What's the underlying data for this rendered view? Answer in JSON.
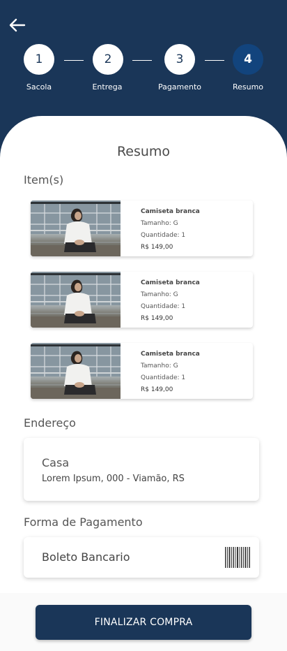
{
  "steps": [
    {
      "number": "1",
      "label": "Sacola"
    },
    {
      "number": "2",
      "label": "Entrega"
    },
    {
      "number": "3",
      "label": "Pagamento"
    },
    {
      "number": "4",
      "label": "Resumo"
    }
  ],
  "active_step": 4,
  "page_title": "Resumo",
  "items_section_title": "Item(s)",
  "items": [
    {
      "name": "Camiseta branca",
      "size_label": "Tamanho:",
      "size": "G",
      "qty_label": "Quantidade:",
      "qty": "1",
      "price": "R$ 149,00"
    },
    {
      "name": "Camiseta branca",
      "size_label": "Tamanho:",
      "size": "G",
      "qty_label": "Quantidade:",
      "qty": "1",
      "price": "R$ 149,00"
    },
    {
      "name": "Camiseta branca",
      "size_label": "Tamanho:",
      "size": "G",
      "qty_label": "Quantidade:",
      "qty": "1",
      "price": "R$ 149,00"
    }
  ],
  "address_section_title": "Endereço",
  "address": {
    "name": "Casa",
    "line": "Lorem Ipsum, 000 - Viamão, RS"
  },
  "payment_section_title": "Forma de Pagamento",
  "payment": {
    "method": "Boleto Bancario",
    "icon": "barcode-icon"
  },
  "finalize_label": "FINALIZAR COMPRA",
  "colors": {
    "primary": "#1a3658",
    "active_step": "#12447d",
    "surface": "#ffffff"
  }
}
